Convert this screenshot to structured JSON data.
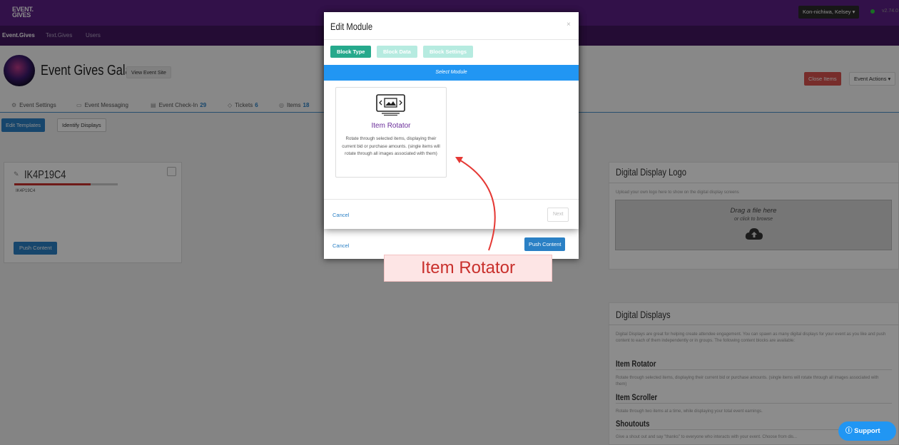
{
  "app": {
    "logo_line1": "EVENT.",
    "logo_line2": "GIVES",
    "user_menu": "Kon-nichiwa, Kelsey ▾",
    "version": "v2.74.0"
  },
  "nav": {
    "items": [
      "Event.Gives",
      "Text.Gives",
      "Users"
    ]
  },
  "header": {
    "title": "Event Gives Gala",
    "view_site": "View Event Site",
    "close_items": "Close Items",
    "event_actions": "Event Actions ▾"
  },
  "tabs": [
    {
      "label": "Event Settings",
      "count": "",
      "icon": "gear-icon"
    },
    {
      "label": "Event Messaging",
      "count": "",
      "icon": "chat-icon"
    },
    {
      "label": "Event Check-In",
      "count": "29",
      "icon": "checkin-icon"
    },
    {
      "label": "Tickets",
      "count": "6",
      "icon": "ticket-icon"
    },
    {
      "label": "Items",
      "count": "18",
      "icon": "eye-icon"
    }
  ],
  "toolbar": {
    "edit_templates": "Edit Templates",
    "identify_displays": "Identify Displays"
  },
  "display_card": {
    "title": "IK4P19C4",
    "subtitle": "IK4P19C4",
    "push": "Push Content",
    "progress": 0.74
  },
  "logo_panel": {
    "title": "Digital Display Logo",
    "text": "Upload your own logo here to show on the digital display screens",
    "drop_main": "Drag a file here",
    "drop_sub": "or click to browse"
  },
  "displays_panel": {
    "title": "Digital Displays",
    "intro": "Digital Displays are great for helping create attendee engagement. You can spawn as many digital displays for your event as you like and push content to each of them independently or in groups. The following content blocks are available:",
    "blocks": [
      {
        "name": "Item Rotator",
        "text": "Rotate through selected items, displaying their current bid or purchase amounts. (single items will rotate through all images associated with them)"
      },
      {
        "name": "Item Scroller",
        "text": "Rotate through two items at a time, while displaying your total event earnings."
      },
      {
        "name": "Shoutouts",
        "text": "Give a shout out and say \"thanks\" to everyone who interacts with your event. Choose from dis..."
      }
    ]
  },
  "modal": {
    "title": "Edit Module",
    "close": "×",
    "steps": [
      "Block Type",
      "Block Data",
      "Block Settings"
    ],
    "select_label": "Select Module",
    "module_name": "Item Rotator",
    "module_desc": "Rotate through selected items, displaying their current bid or purchase amounts. (single items will rotate through all images associated with them)",
    "cancel": "Cancel",
    "next": "Next"
  },
  "back_modal": {
    "cancel": "Cancel",
    "push": "Push Content"
  },
  "callout": "Item Rotator",
  "support": "Support",
  "colors": {
    "brand": "#5b1f86",
    "nav": "#42175f",
    "accent": "#2a80c5",
    "teal": "#26a98c",
    "select_bar": "#2196f3",
    "danger": "#c9302c"
  }
}
